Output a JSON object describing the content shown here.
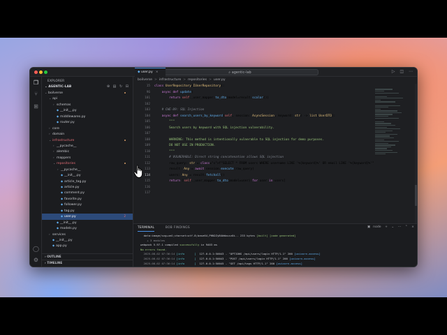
{
  "window": {
    "title": "agentic-lab"
  },
  "sidebar": {
    "title": "EXPLORER",
    "project": "AGENTIC-LAB",
    "outline_label": "OUTLINE",
    "timeline_label": "TIMELINE",
    "items": [
      {
        "label": "boilverse",
        "depth": 0,
        "type": "folder",
        "open": true,
        "dot": true
      },
      {
        "label": "api",
        "depth": 1,
        "type": "folder",
        "open": true
      },
      {
        "label": "schemas",
        "depth": 2,
        "type": "folder",
        "open": false
      },
      {
        "label": "__init__.py",
        "depth": 2,
        "type": "file"
      },
      {
        "label": "middlewares.py",
        "depth": 2,
        "type": "file"
      },
      {
        "label": "router.py",
        "depth": 2,
        "type": "file"
      },
      {
        "label": "core",
        "depth": 1,
        "type": "folder",
        "open": false
      },
      {
        "label": "domain",
        "depth": 1,
        "type": "folder",
        "open": false
      },
      {
        "label": "infrastructure",
        "depth": 1,
        "type": "folder",
        "open": true,
        "special": true,
        "dot": true
      },
      {
        "label": "__pycache__",
        "depth": 2,
        "type": "folder",
        "open": false
      },
      {
        "label": "alembic",
        "depth": 2,
        "type": "folder",
        "open": false
      },
      {
        "label": "mappers",
        "depth": 2,
        "type": "folder",
        "open": false
      },
      {
        "label": "repositories",
        "depth": 2,
        "type": "folder",
        "open": true,
        "special": true,
        "dot": true
      },
      {
        "label": "__pycache__",
        "depth": 3,
        "type": "folder",
        "open": false
      },
      {
        "label": "__init__.py",
        "depth": 3,
        "type": "file"
      },
      {
        "label": "article_tag.py",
        "depth": 3,
        "type": "file"
      },
      {
        "label": "article.py",
        "depth": 3,
        "type": "file"
      },
      {
        "label": "comment.py",
        "depth": 3,
        "type": "file"
      },
      {
        "label": "favorite.py",
        "depth": 3,
        "type": "file"
      },
      {
        "label": "follower.py",
        "depth": 3,
        "type": "file"
      },
      {
        "label": "tag.py",
        "depth": 3,
        "type": "file"
      },
      {
        "label": "user.py",
        "depth": 3,
        "type": "file",
        "selected": true,
        "badge": "2"
      },
      {
        "label": "__init__.py",
        "depth": 2,
        "type": "file"
      },
      {
        "label": "models.py",
        "depth": 2,
        "type": "file"
      },
      {
        "label": "services",
        "depth": 1,
        "type": "folder",
        "open": false
      },
      {
        "label": "__init__.py",
        "depth": 1,
        "type": "file"
      },
      {
        "label": "app.py",
        "depth": 1,
        "type": "file"
      }
    ]
  },
  "editor": {
    "tab_label": "user.py",
    "breadcrumb": [
      "boilverse",
      "infrastructure",
      "repositories",
      "user.py"
    ],
    "breadcrumb_sep": ">",
    "current_line": "114",
    "lines": [
      {
        "n": "15",
        "text": "class UserRepository(IUserRepository):"
      },
      {
        "n": "96",
        "text": "    async def update("
      },
      {
        "n": "101",
        "text": "        return self._user_mapper.to_dto(model=result.scalar())"
      },
      {
        "n": "102",
        "text": ""
      },
      {
        "n": "103",
        "text": "    # CWE-89: SQL Injection"
      },
      {
        "n": "104",
        "text": "    async def search_users_by_keyword(self, session: AsyncSession, keyword: str) -> list[UserDTO]:"
      },
      {
        "n": "105",
        "text": "        \"\"\""
      },
      {
        "n": "106",
        "text": "        Search users by keyword with SQL injection vulnerability."
      },
      {
        "n": "107",
        "text": ""
      },
      {
        "n": "108",
        "text": "        WARNING: This method is intentionally vulnerable to SQL injection for demo purposes."
      },
      {
        "n": "109",
        "text": "        DO NOT USE IN PRODUCTION."
      },
      {
        "n": "110",
        "text": "        \"\"\""
      },
      {
        "n": "111",
        "text": "        # VULNERABLE: Direct string concatenation allows SQL injection"
      },
      {
        "n": "112",
        "text": "        raw_query: str = f\"SELECT * FROM users WHERE username LIKE '%{keyword}%' OR email LIKE '%{keyword}%'\""
      },
      {
        "n": "113",
        "text": "        result: Any = await session.execute(raw_query)"
      },
      {
        "n": "114",
        "text": "        users: Any = result.fetchall()"
      },
      {
        "n": "115",
        "text": "        return [self._user_mapper.to_dto(model=user) for user in users]"
      },
      {
        "n": "116",
        "text": ""
      },
      {
        "n": "117",
        "text": ""
      }
    ]
  },
  "panel": {
    "tabs": [
      "TERMINAL",
      "BOB FINDINGS"
    ],
    "active_tab": "TERMINAL",
    "shell_label": "node",
    "lines": [
      {
        "parts": [
          {
            "t": "  data:image/svg+xml;charset=utf-8;base64,PHN2ZyB4bWxucz0i.. 233 bytes ",
            "c": ""
          },
          {
            "t": "[built] [code generated]",
            "c": "tg"
          }
        ]
      },
      {
        "parts": [
          {
            "t": "    + 3 modules",
            "c": "tgray"
          }
        ]
      },
      {
        "parts": [
          {
            "t": "webpack 5.97.1 compiled ",
            "c": ""
          },
          {
            "t": "successfully",
            "c": "tg"
          },
          {
            "t": " in 9403 ms",
            "c": ""
          }
        ]
      },
      {
        "parts": [
          {
            "t": "No errors found.",
            "c": "tg"
          }
        ]
      },
      {
        "parts": [
          {
            "t": "  2025-08-02 07:36:14 ",
            "c": "tgray"
          },
          {
            "t": "[info      ]",
            "c": "tc"
          },
          {
            "t": "  127.0.0.1:50043 - \"OPTIONS /api/users/login HTTP/1.1\" 200 ",
            "c": ""
          },
          {
            "t": "[uvicorn.access]",
            "c": "tb"
          }
        ]
      },
      {
        "parts": [
          {
            "t": "  2025-08-02 07:36:14 ",
            "c": "tgray"
          },
          {
            "t": "[info      ]",
            "c": "tc"
          },
          {
            "t": "  127.0.0.1:50043 - \"POST /api/users/login HTTP/1.1\" 200 ",
            "c": ""
          },
          {
            "t": "[uvicorn.access]",
            "c": "tb"
          }
        ]
      },
      {
        "parts": [
          {
            "t": "  2025-08-02 07:36:14 ",
            "c": "tgray"
          },
          {
            "t": "[info      ]",
            "c": "tc"
          },
          {
            "t": "  127.0.0.1:50045 - \"GET /api/tags HTTP/1.1\" 200 ",
            "c": ""
          },
          {
            "t": "[uvicorn.access]",
            "c": "tb"
          }
        ]
      },
      {
        "parts": [
          {
            "t": "  2025-08-02 07:36:14 ",
            "c": "tgray"
          },
          {
            "t": "[info      ]",
            "c": "tc"
          },
          {
            "t": "  127.0.0.1:50047 - \"GET /api/articles?offset=0&limit=100 HTTP/1.1\" 200 ",
            "c": ""
          },
          {
            "t": "[uvicorn.access]",
            "c": "tb"
          }
        ]
      },
      {
        "parts": [
          {
            "t": "[]",
            "c": "tgray"
          }
        ]
      }
    ]
  },
  "colors": {
    "accent": "#2c4a7a",
    "error": "#e06c75",
    "success": "#98c379"
  }
}
